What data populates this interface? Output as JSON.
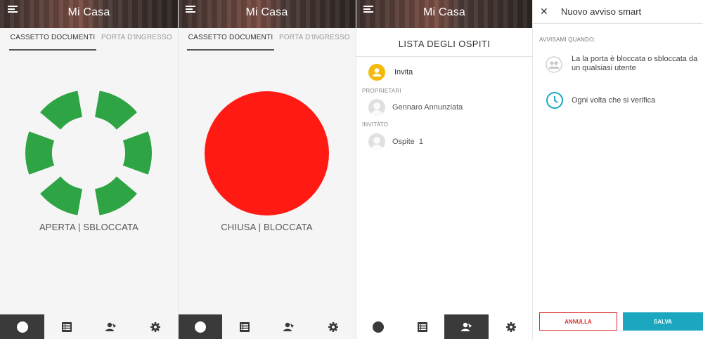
{
  "header": {
    "title": "Mi Casa"
  },
  "tabs": {
    "cassetto": "CASSETTO DOCUMENTI",
    "porta": "PORTA D'INGRESSO"
  },
  "panel_open": {
    "status": "APERTA | SBLOCCATA",
    "color": "#2ea444"
  },
  "panel_closed": {
    "status": "CHIUSA | BLOCCATA",
    "color": "#ff1a14"
  },
  "guest_list": {
    "title": "LISTA DEGLI OSPITI",
    "invite_label": "Invita",
    "owners_label": "PROPRIETARI",
    "owner_name": "Gennaro Annunziata",
    "invited_label": "INVITATO",
    "guest_name": "Ospite  1"
  },
  "smart_alert": {
    "title": "Nuovo avviso smart",
    "notify_label": "AVVISAMI QUANDO:",
    "option1": "La la porta è bloccata o sbloccata da un qualsiasi utente",
    "option2": "Ogni volta che si verifica",
    "cancel_label": "ANNULLA",
    "save_label": "SALVA"
  },
  "colors": {
    "accent": "#1ca7c1",
    "danger": "#d9312c",
    "invite": "#f5b90c"
  },
  "icons": [
    "menu-icon",
    "circle-icon",
    "list-icon",
    "users-icon",
    "gear-icon",
    "close-icon",
    "group-icon",
    "clock-icon"
  ]
}
